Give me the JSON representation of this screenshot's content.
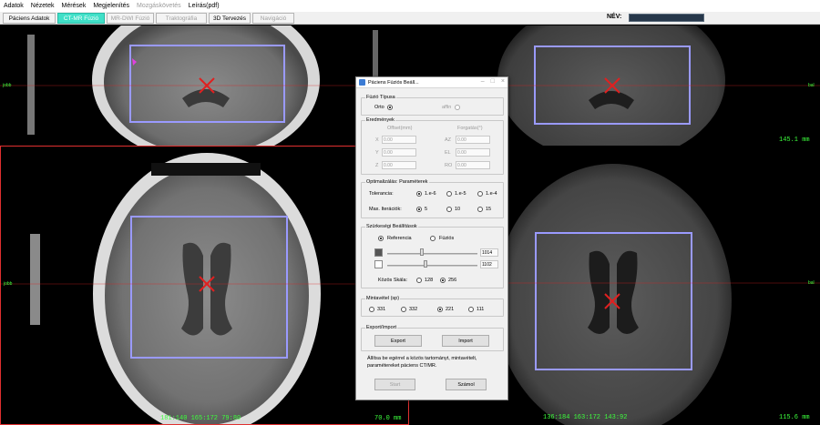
{
  "menu": [
    "Adatok",
    "Nézetek",
    "Mérések",
    "Megjelenítés",
    "Mozgáskövetés",
    "Leírás(pdf)"
  ],
  "menu_disabled": [
    false,
    false,
    false,
    false,
    true,
    false
  ],
  "tabs": [
    {
      "label": "Páciens Adatok",
      "state": "normal"
    },
    {
      "label": "CT-MR Fúzió",
      "state": "active"
    },
    {
      "label": "MR-DWI Fúzió",
      "state": "disabled"
    },
    {
      "label": "Traktográfia",
      "state": "disabled"
    },
    {
      "label": "3D Tervezés",
      "state": "normal"
    },
    {
      "label": "Navigáció",
      "state": "disabled"
    }
  ],
  "name_label": "NÉV:",
  "viewports": {
    "ct_top": {
      "side_label": "jobb"
    },
    "ct_main": {
      "side_label": "jobb",
      "coords": "181:140 165:172 79:80",
      "distance": "70.0 mm"
    },
    "mr_top": {
      "side_label": "bal",
      "distance": "145.1 mm"
    },
    "mr_main": {
      "side_label": "bal",
      "coords": "136:184 163:172 143:92",
      "distance": "115.6 mm"
    }
  },
  "dialog": {
    "title": "Páciens Fúziós Beáll...",
    "fusion_type": {
      "label": "Fúzió Típusa",
      "options": [
        {
          "label": "Orto",
          "selected": true
        },
        {
          "label": "affin",
          "selected": false,
          "disabled": true
        }
      ]
    },
    "results": {
      "label": "Eredmények",
      "offset_label": "Offset(mm)",
      "rotation_label": "Forgatás(°)",
      "rows": [
        {
          "axis": "X",
          "offset": "0.00",
          "rot_axis": "AZ",
          "rot": "0.00"
        },
        {
          "axis": "Y",
          "offset": "0.00",
          "rot_axis": "EL",
          "rot": "0.00"
        },
        {
          "axis": "Z",
          "offset": "0.00",
          "rot_axis": "RO",
          "rot": "0.00"
        }
      ]
    },
    "optimization": {
      "label": "Optimalizálás: Paraméterek",
      "tolerance_label": "Tolerancia:",
      "tolerance_options": [
        {
          "label": "1.e-6",
          "selected": true
        },
        {
          "label": "1.e-5",
          "selected": false
        },
        {
          "label": "1.e-4",
          "selected": false
        }
      ],
      "iterations_label": "Max. Iterációk:",
      "iterations_options": [
        {
          "label": "5",
          "selected": true
        },
        {
          "label": "10",
          "selected": false
        },
        {
          "label": "15",
          "selected": false
        }
      ]
    },
    "grayscale": {
      "label": "Szürkeségi Beállítások",
      "options": [
        {
          "label": "Referencia",
          "selected": true
        },
        {
          "label": "Fúziós",
          "selected": false
        }
      ],
      "upper_value": "1014",
      "lower_value": "1102",
      "upper_slider": 0.38,
      "lower_slider": 0.42,
      "levels_label": "Közös Skála:",
      "levels_options": [
        {
          "label": "128",
          "selected": false
        },
        {
          "label": "256",
          "selected": true
        }
      ]
    },
    "sampling": {
      "label": "Mintavétel (sp)",
      "options": [
        {
          "label": "331",
          "selected": false
        },
        {
          "label": "332",
          "selected": false
        },
        {
          "label": "221",
          "selected": true
        },
        {
          "label": "111",
          "selected": false
        }
      ]
    },
    "export_import": {
      "label": "Export/Import",
      "export_label": "Export",
      "import_label": "Import"
    },
    "description": "Állítsa be egérrel a közös tartományt, mintavételt, paramétereket páciens CT/MR.",
    "start_label": "Start",
    "calc_label": "Számol"
  },
  "colors": {
    "accent_tab": "#40e0c8",
    "roi_box": "#9a9aff",
    "crosshair": "#e02020",
    "status_text": "#3dff3d",
    "active_viewport_border": "#e03030"
  },
  "icons": [
    "app-icon",
    "minimize-icon",
    "maximize-icon",
    "close-icon"
  ]
}
